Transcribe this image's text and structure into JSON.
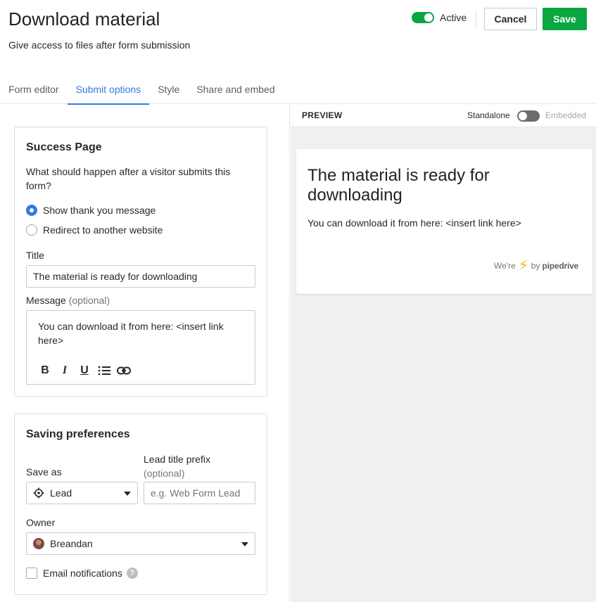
{
  "header": {
    "title": "Download material",
    "subtitle": "Give access to files after form submission",
    "active_label": "Active",
    "cancel_label": "Cancel",
    "save_label": "Save"
  },
  "tabs": [
    {
      "label": "Form editor",
      "active": false
    },
    {
      "label": "Submit options",
      "active": true
    },
    {
      "label": "Style",
      "active": false
    },
    {
      "label": "Share and embed",
      "active": false
    }
  ],
  "success_page": {
    "title": "Success Page",
    "question": "What should happen after a visitor submits this form?",
    "options": [
      {
        "label": "Show thank you message",
        "checked": true
      },
      {
        "label": "Redirect to another website",
        "checked": false
      }
    ],
    "title_label": "Title",
    "title_value": "The material is ready for downloading",
    "message_label": "Message",
    "message_optional": "(optional)",
    "message_value": "You can download it from here: <insert link here>"
  },
  "saving_preferences": {
    "title": "Saving preferences",
    "save_as_label": "Save as",
    "save_as_value": "Lead",
    "prefix_label": "Lead title prefix",
    "prefix_optional": "(optional)",
    "prefix_placeholder": "e.g. Web Form Lead",
    "owner_label": "Owner",
    "owner_value": "Breandan",
    "email_notifications_label": "Email notifications",
    "help_glyph": "?"
  },
  "preview": {
    "label": "PREVIEW",
    "standalone_label": "Standalone",
    "embedded_label": "Embedded",
    "title": "The material is ready for downloading",
    "message": "You can download it from here: <insert link here>",
    "brand_prefix": "We're",
    "brand_suffix": "by",
    "brand_name": "pipedrive"
  },
  "colors": {
    "accent": "#317ae2",
    "success": "#08a742",
    "brand_bolt": "#f7b500"
  }
}
